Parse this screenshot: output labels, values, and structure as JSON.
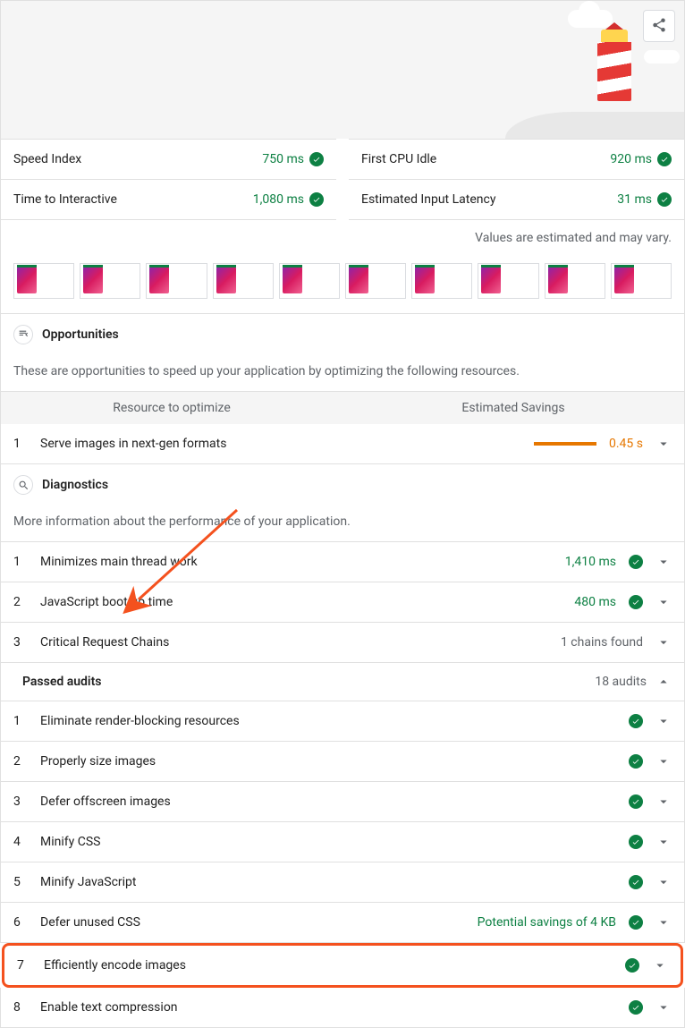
{
  "metrics": {
    "left": [
      {
        "label": "Speed Index",
        "value": "750 ms"
      },
      {
        "label": "Time to Interactive",
        "value": "1,080 ms"
      }
    ],
    "right": [
      {
        "label": "First CPU Idle",
        "value": "920 ms"
      },
      {
        "label": "Estimated Input Latency",
        "value": "31 ms"
      }
    ]
  },
  "disclaimer": "Values are estimated and may vary.",
  "filmstrip_count": 10,
  "opportunities": {
    "title": "Opportunities",
    "desc": "These are opportunities to speed up your application by optimizing the following resources.",
    "col1": "Resource to optimize",
    "col2": "Estimated Savings",
    "items": [
      {
        "num": "1",
        "title": "Serve images in next-gen formats",
        "value": "0.45 s"
      }
    ]
  },
  "diagnostics": {
    "title": "Diagnostics",
    "desc": "More information about the performance of your application.",
    "items": [
      {
        "num": "1",
        "title": "Minimizes main thread work",
        "value": "1,410 ms",
        "pass": true
      },
      {
        "num": "2",
        "title": "JavaScript boot-up time",
        "value": "480 ms",
        "pass": true
      },
      {
        "num": "3",
        "title": "Critical Request Chains",
        "value": "1 chains found",
        "pass": false
      }
    ]
  },
  "passed": {
    "title": "Passed audits",
    "count": "18 audits",
    "items": [
      {
        "num": "1",
        "title": "Eliminate render-blocking resources",
        "value": ""
      },
      {
        "num": "2",
        "title": "Properly size images",
        "value": ""
      },
      {
        "num": "3",
        "title": "Defer offscreen images",
        "value": ""
      },
      {
        "num": "4",
        "title": "Minify CSS",
        "value": ""
      },
      {
        "num": "5",
        "title": "Minify JavaScript",
        "value": ""
      },
      {
        "num": "6",
        "title": "Defer unused CSS",
        "value": "Potential savings of 4 KB"
      },
      {
        "num": "7",
        "title": "Efficiently encode images",
        "value": "",
        "highlight": true
      },
      {
        "num": "8",
        "title": "Enable text compression",
        "value": ""
      }
    ]
  }
}
